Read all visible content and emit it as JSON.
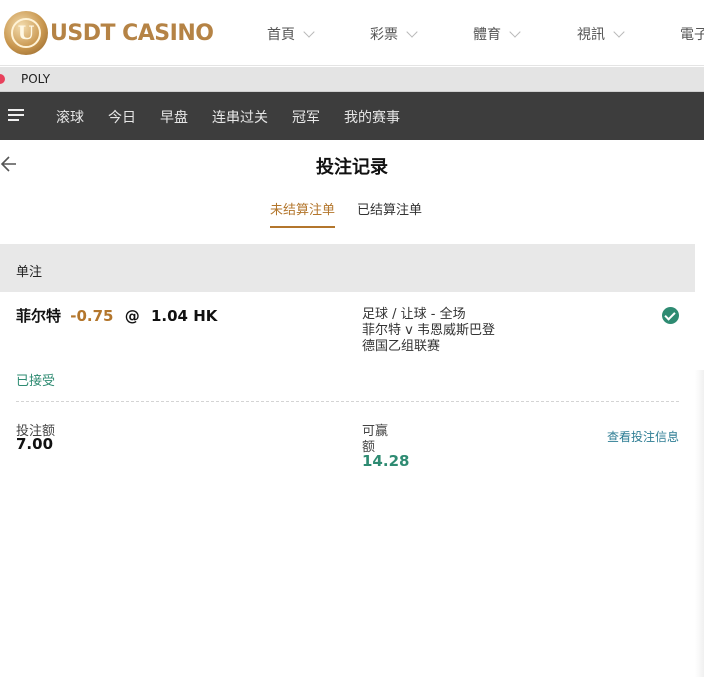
{
  "site": {
    "logo_mark": "U",
    "logo_text": "USDT CASINO",
    "nav": [
      {
        "label": "首頁"
      },
      {
        "label": "彩票"
      },
      {
        "label": "體育"
      },
      {
        "label": "視訊"
      },
      {
        "label": "電子"
      }
    ]
  },
  "tab": {
    "label": "POLY"
  },
  "sports_menu": {
    "items": [
      "滚球",
      "今日",
      "早盘",
      "连串过关",
      "冠军",
      "我的赛事"
    ]
  },
  "page": {
    "title": "投注记录",
    "tabs": [
      {
        "label": "未结算注单",
        "active": true
      },
      {
        "label": "已结算注单",
        "active": false
      }
    ]
  },
  "section": {
    "title": "单注"
  },
  "bet": {
    "selection": "菲尔特",
    "handicap": "-0.75",
    "at": "@",
    "odds": "1.04 HK",
    "market": "足球 / 让球 - 全场",
    "match": "菲尔特 v 韦恩威斯巴登",
    "league": "德国乙组联赛",
    "status": "已接受",
    "stake_label": "投注额",
    "stake_value": "7.00",
    "win_label_line1": "可赢",
    "win_label_line2": "额",
    "win_value": "14.28",
    "view_link": "查看投注信息"
  },
  "colors": {
    "accent": "#b3762c",
    "green": "#2e8b72",
    "dark_bar": "#3d3d3d"
  }
}
